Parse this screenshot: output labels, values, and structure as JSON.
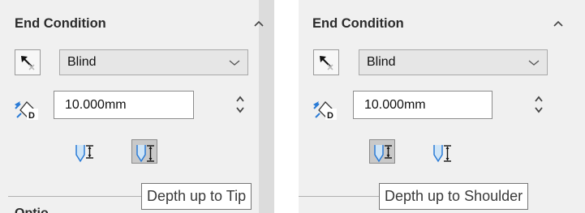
{
  "panels": [
    {
      "section_title": "End Condition",
      "end_condition": {
        "selected": "Blind"
      },
      "depth": {
        "value": "10.000mm"
      },
      "options": {
        "pressed": "tip"
      },
      "partial_label": "Optio",
      "tooltip": "Depth up to Tip"
    },
    {
      "section_title": "End Condition",
      "end_condition": {
        "selected": "Blind"
      },
      "depth": {
        "value": "10.000mm"
      },
      "options": {
        "pressed": "shoulder"
      },
      "tooltip": "Depth up to Shoulder"
    }
  ],
  "icons": {
    "collapse": "chevron-up-icon",
    "end_type": "direction-arrow-icon",
    "dropdown": "chevron-down-icon",
    "depth": "depth-dimension-icon",
    "spinner": "spinner-arrows-icon",
    "tip": "depth-to-tip-icon",
    "shoulder": "depth-to-shoulder-icon"
  },
  "colors": {
    "panel_bg": "#f0f0f0",
    "pressed_bg": "#c9c9c9",
    "icon_blue": "#2a7bd6"
  }
}
